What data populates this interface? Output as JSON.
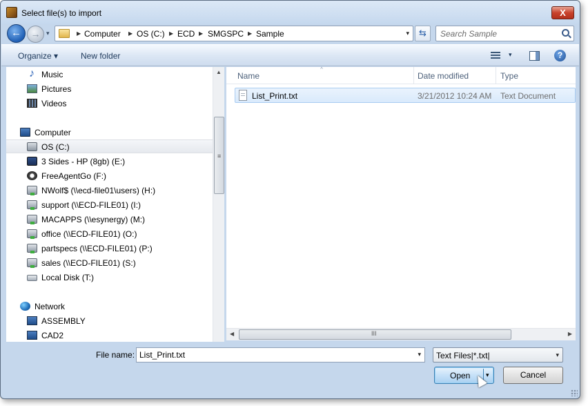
{
  "window": {
    "title": "Select file(s) to import"
  },
  "titlebar": {
    "close_glyph": "X"
  },
  "nav": {
    "back_glyph": "←",
    "forward_glyph": "→",
    "recent_glyph": "▾",
    "breadcrumbs": [
      "Computer",
      "OS (C:)",
      "ECD",
      "SMGSPC",
      "Sample"
    ],
    "separator_glyph": "▶",
    "dropdown_glyph": "▾",
    "refresh_glyph": "⇆",
    "search_placeholder": "Search Sample"
  },
  "toolbar": {
    "organize_label": "Organize ▾",
    "new_folder_label": "New folder",
    "views_drop_glyph": "▾",
    "help_glyph": "?"
  },
  "navpane": {
    "items": [
      {
        "label": "Music",
        "icon": "music-icon"
      },
      {
        "label": "Pictures",
        "icon": "pictures-icon"
      },
      {
        "label": "Videos",
        "icon": "videos-icon"
      },
      {
        "label": "Computer",
        "icon": "computer-icon"
      },
      {
        "label": "OS (C:)",
        "icon": "drive-icon",
        "selected": true
      },
      {
        "label": "3 Sides - HP (8gb) (E:)",
        "icon": "hp-drive-icon"
      },
      {
        "label": "FreeAgentGo (F:)",
        "icon": "external-drive-icon"
      },
      {
        "label": "NWolf$ (\\\\ecd-file01\\users) (H:)",
        "icon": "network-drive-icon"
      },
      {
        "label": "support (\\\\ECD-FILE01) (I:)",
        "icon": "network-drive-icon"
      },
      {
        "label": "MACAPPS (\\\\esynergy) (M:)",
        "icon": "network-drive-icon"
      },
      {
        "label": "office (\\\\ECD-FILE01) (O:)",
        "icon": "network-drive-icon"
      },
      {
        "label": "partspecs (\\\\ECD-FILE01) (P:)",
        "icon": "network-drive-icon"
      },
      {
        "label": "sales (\\\\ECD-FILE01) (S:)",
        "icon": "network-drive-icon"
      },
      {
        "label": "Local Disk (T:)",
        "icon": "local-disk-icon"
      },
      {
        "label": "Network",
        "icon": "network-icon"
      },
      {
        "label": "ASSEMBLY",
        "icon": "network-computer-icon"
      },
      {
        "label": "CAD2",
        "icon": "network-computer-icon"
      }
    ],
    "scroll_up_glyph": "▲",
    "grip_glyph": "≡"
  },
  "filelist": {
    "columns": [
      "Name",
      "Date modified",
      "Type"
    ],
    "sort_glyph": "˄",
    "rows": [
      {
        "name": "List_Print.txt",
        "date": "3/21/2012 10:24 AM",
        "type": "Text Document"
      }
    ],
    "hscroll": {
      "left_glyph": "◀",
      "right_glyph": "▶",
      "grip_glyph": "III"
    }
  },
  "footer": {
    "filename_label": "File name:",
    "filename_value": "List_Print.txt",
    "filter_value": "Text Files|*.txt|",
    "drop_glyph": "▾",
    "open_label": "Open",
    "cancel_label": "Cancel"
  }
}
